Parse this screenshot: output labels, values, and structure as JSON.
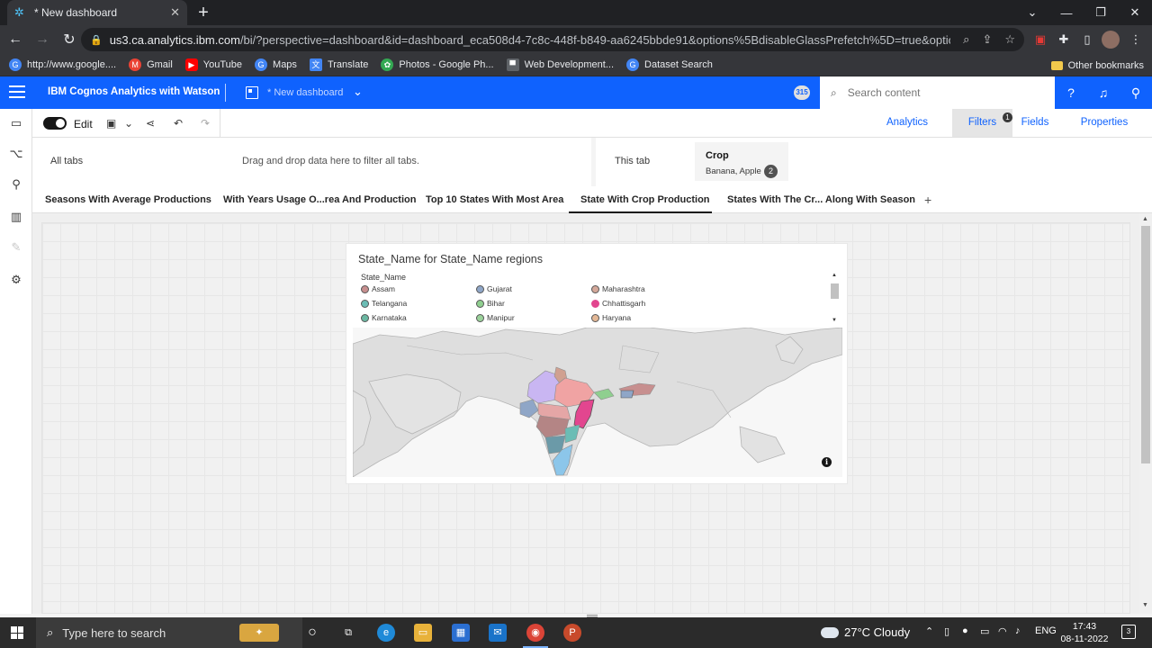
{
  "browser": {
    "tab_title": "* New dashboard",
    "url_host": "us3.ca.analytics.ibm.com",
    "url_path": "/bi/?perspective=dashboard&id=dashboard_eca508d4-7c8c-448f-b849-aa6245bbde91&options%5BdisableGlassPrefetch%5D=true&options%5Bcollection...",
    "bookmarks": [
      {
        "label": "http://www.google....",
        "icon": "google-icon",
        "color": "#4285f4"
      },
      {
        "label": "Gmail",
        "icon": "gmail-icon",
        "color": "#ea4335"
      },
      {
        "label": "YouTube",
        "icon": "youtube-icon",
        "color": "#ff0000"
      },
      {
        "label": "Maps",
        "icon": "google-icon",
        "color": "#4285f4"
      },
      {
        "label": "Translate",
        "icon": "translate-icon",
        "color": "#4285f4"
      },
      {
        "label": "Photos - Google Ph...",
        "icon": "photos-icon",
        "color": "#fbbc05"
      },
      {
        "label": "Web Development...",
        "icon": "bookmark-icon",
        "color": "#5f6368"
      },
      {
        "label": "Dataset Search",
        "icon": "google-icon",
        "color": "#4285f4"
      }
    ],
    "other_bookmarks": "Other bookmarks"
  },
  "app": {
    "brand": "IBM Cognos Analytics with Watson",
    "dashboard_name": "* New dashboard",
    "notification_count": "315",
    "search_placeholder": "Search content",
    "accent": "#0f62fe"
  },
  "toolbar": {
    "edit_label": "Edit",
    "right_tabs": [
      "Analytics",
      "Filters",
      "Fields",
      "Properties"
    ],
    "active_right_tab": "Filters",
    "filters_badge": "1"
  },
  "filters": {
    "all_tabs_label": "All tabs",
    "drag_message": "Drag and drop data here to filter all tabs.",
    "this_tab_label": "This tab",
    "chip": {
      "title": "Crop",
      "values": "Banana, Apple",
      "count": "2"
    }
  },
  "tabs": [
    "Seasons With Average Productions",
    "With Years Usage O...rea And Production",
    "Top 10 States With Most Area",
    "State With Crop Production",
    "States With The Cr... Along With Season"
  ],
  "active_tab_index": 3,
  "widget": {
    "title": "State_Name for State_Name regions",
    "legend_title": "State_Name",
    "legend_items": [
      {
        "label": "Assam",
        "color": "#c78f8f"
      },
      {
        "label": "Gujarat",
        "color": "#8fa6c7"
      },
      {
        "label": "Maharashtra",
        "color": "#d4a89a"
      },
      {
        "label": "Telangana",
        "color": "#6bbdb5"
      },
      {
        "label": "Bihar",
        "color": "#8fcf8f"
      },
      {
        "label": "Chhattisgarh",
        "color": "#e2468f"
      },
      {
        "label": "Karnataka",
        "color": "#6bb8a2"
      },
      {
        "label": "Manipur",
        "color": "#9bd29b"
      },
      {
        "label": "Haryana",
        "color": "#e3b896"
      }
    ]
  },
  "taskbar": {
    "search_placeholder": "Type here to search",
    "weather": "27°C  Cloudy",
    "lang": "ENG",
    "time": "17:43",
    "date": "08-11-2022",
    "notification_count": "3"
  }
}
